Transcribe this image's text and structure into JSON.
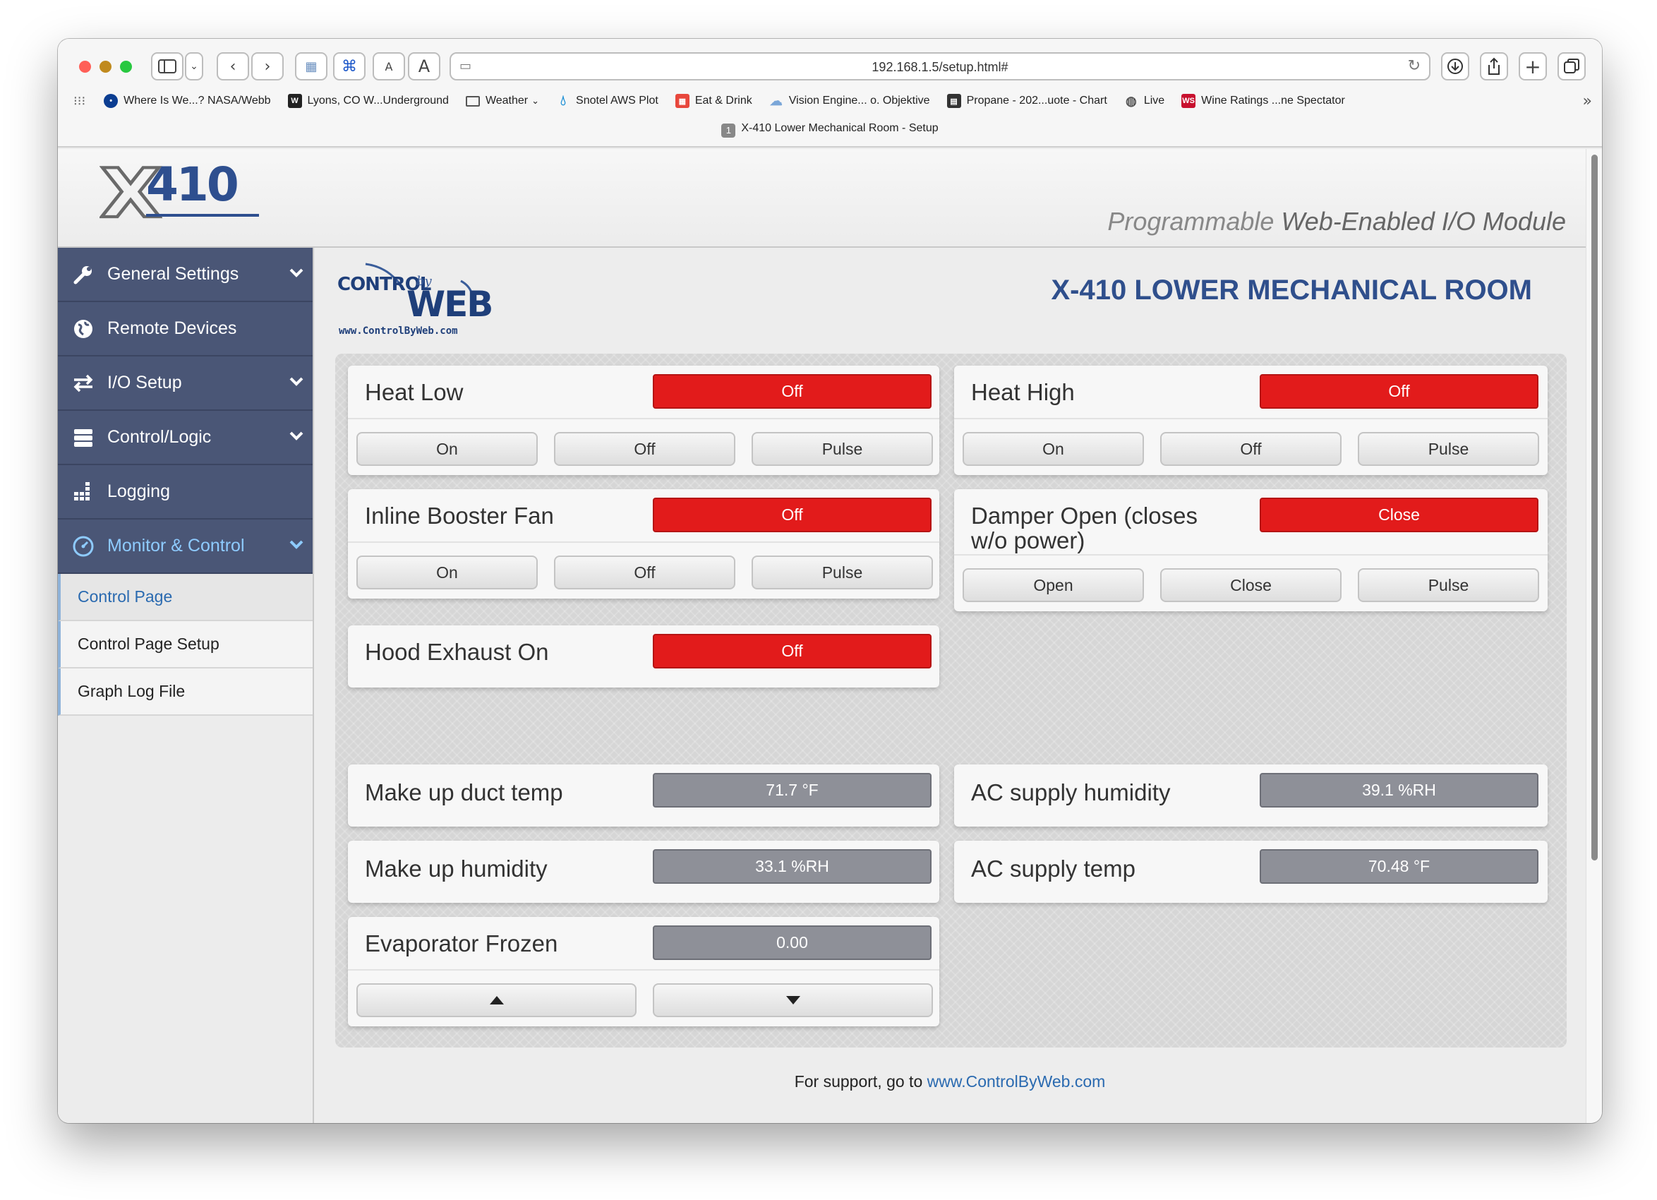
{
  "browser": {
    "url": "192.168.1.5/setup.html#",
    "tab_title": "X-410 Lower Mechanical Room - Setup",
    "tab_index": "1",
    "reader_a_small": "A",
    "reader_a_large": "A",
    "bookmarks": [
      {
        "label": "Where Is We...? NASA/Webb",
        "icon": "nasa-icon",
        "color": "#0b3d91"
      },
      {
        "label": "Lyons, CO W...Underground",
        "icon": "wunderground-icon",
        "color": "#222222"
      },
      {
        "label": "Weather",
        "icon": "folder-icon",
        "color": "#555555"
      },
      {
        "label": "Snotel AWS Plot",
        "icon": "water-drop-icon",
        "color": "#1b8fd6"
      },
      {
        "label": "Eat & Drink",
        "icon": "grid-icon",
        "color": "#e8473c"
      },
      {
        "label": "Vision Engine... o. Objektive",
        "icon": "cloud-icon",
        "color": "#7aa6d8"
      },
      {
        "label": "Propane - 202...uote - Chart",
        "icon": "propane-icon",
        "color": "#333333"
      },
      {
        "label": "Live",
        "icon": "globe-icon",
        "color": "#555555"
      },
      {
        "label": "Wine Ratings ...ne Spectator",
        "icon": "ws-icon",
        "color": "#c8102e"
      }
    ]
  },
  "header": {
    "logo_x": "X",
    "logo_num": "410",
    "tagline_a": "Programmable ",
    "tagline_b": "Web-Enabled I/O Module"
  },
  "sidebar": {
    "items": [
      {
        "label": "General Settings",
        "icon": "wrench-icon",
        "chevron": true
      },
      {
        "label": "Remote Devices",
        "icon": "globe-icon",
        "chevron": false
      },
      {
        "label": "I/O Setup",
        "icon": "swap-arrows-icon",
        "chevron": true
      },
      {
        "label": "Control/Logic",
        "icon": "server-icon",
        "chevron": true
      },
      {
        "label": "Logging",
        "icon": "bar-chart-icon",
        "chevron": false
      },
      {
        "label": "Monitor & Control",
        "icon": "gauge-icon",
        "chevron": true
      }
    ],
    "subitems": [
      {
        "label": "Control Page"
      },
      {
        "label": "Control Page Setup"
      },
      {
        "label": "Graph Log File"
      }
    ]
  },
  "main": {
    "brand_top": "CONTROL",
    "brand_by": "by",
    "brand_web": "WEB",
    "brand_url": "www.ControlByWeb.com",
    "room_title": "X-410 LOWER MECHANICAL ROOM",
    "relays": [
      {
        "label": "Heat Low",
        "status": "Off",
        "buttons": [
          "On",
          "Off",
          "Pulse"
        ]
      },
      {
        "label": "Heat High",
        "status": "Off",
        "buttons": [
          "On",
          "Off",
          "Pulse"
        ]
      },
      {
        "label": "Inline Booster Fan",
        "status": "Off",
        "buttons": [
          "On",
          "Off",
          "Pulse"
        ]
      },
      {
        "label": "Damper Open (closes w/o power)",
        "status": "Close",
        "buttons": [
          "Open",
          "Close",
          "Pulse"
        ]
      },
      {
        "label": "Hood Exhaust On",
        "status": "Off"
      }
    ],
    "sensors": [
      {
        "label": "Make up duct temp",
        "value": "71.7 °F"
      },
      {
        "label": "AC supply humidity",
        "value": "39.1 %RH"
      },
      {
        "label": "Make up humidity",
        "value": "33.1 %RH"
      },
      {
        "label": "AC supply temp",
        "value": "70.48 °F"
      },
      {
        "label": "Evaporator Frozen",
        "value": "0.00"
      }
    ],
    "footer_text": "For support, go to ",
    "footer_link": "www.ControlByWeb.com"
  },
  "colors": {
    "nav_bg": "#4a5676",
    "status_on_red": "#e21b1b",
    "status_gray": "#8e9098",
    "title_blue": "#2f4f8c"
  }
}
